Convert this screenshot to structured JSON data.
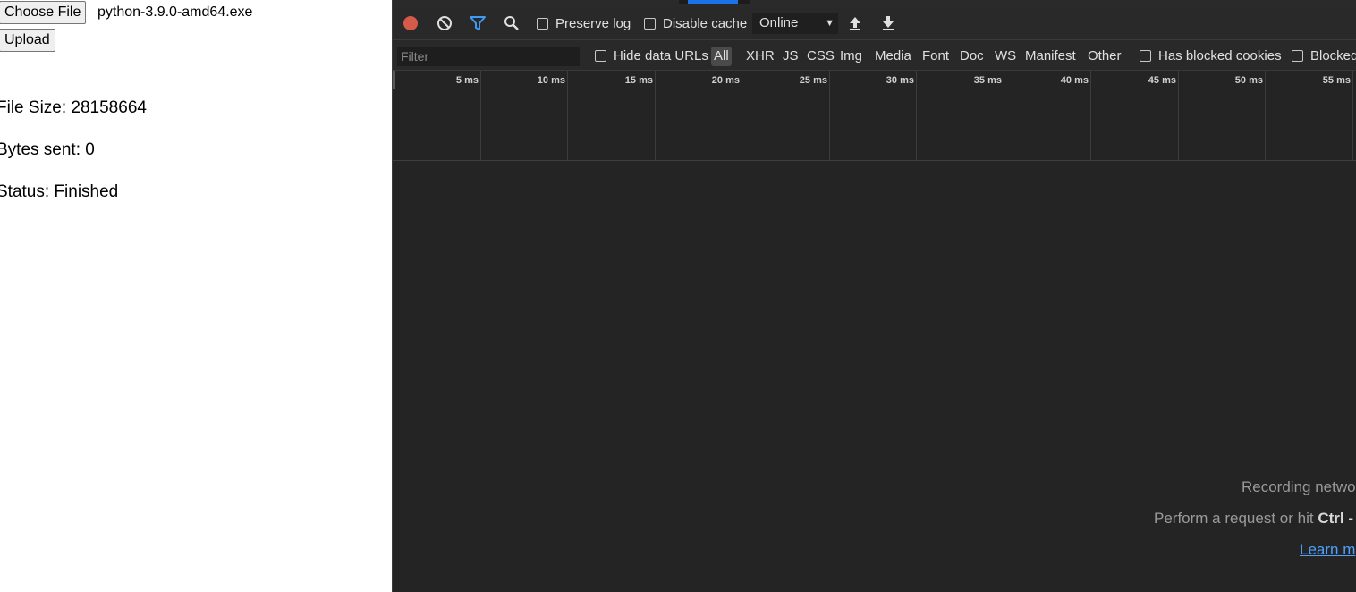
{
  "webpage": {
    "choose_file_label": "Choose File",
    "file_name": "python-3.9.0-amd64.exe",
    "upload_label": "Upload",
    "file_size_text": "File Size: 28158664",
    "bytes_sent_text": "Bytes sent: 0",
    "status_text": "Status: Finished"
  },
  "devtools": {
    "toolbar": {
      "record_icon": "record-icon",
      "clear_icon": "clear-icon",
      "filter_icon": "filter-icon",
      "search_icon": "search-icon",
      "preserve_log_label": "Preserve log",
      "disable_cache_label": "Disable cache",
      "throttle_value": "Online",
      "import_icon": "upload-icon",
      "export_icon": "download-icon"
    },
    "filter_bar": {
      "filter_placeholder": "Filter",
      "hide_data_urls_label": "Hide data URLs",
      "types": [
        "All",
        "XHR",
        "JS",
        "CSS",
        "Img",
        "Media",
        "Font",
        "Doc",
        "WS",
        "Manifest",
        "Other"
      ],
      "has_blocked_cookies_label": "Has blocked cookies",
      "blocked_requests_label": "Blocked"
    },
    "timeline_ticks": [
      "5 ms",
      "10 ms",
      "15 ms",
      "20 ms",
      "25 ms",
      "30 ms",
      "35 ms",
      "40 ms",
      "45 ms",
      "50 ms",
      "55 ms"
    ],
    "empty_state": {
      "line1": "Recording netwo",
      "line2_prefix": "Perform a request or hit ",
      "line2_key": "Ctrl -",
      "learn_more": "Learn m"
    },
    "colors": {
      "record": "#d45a4a",
      "filter_active": "#3d9bf5",
      "link": "#4ea1ff",
      "panel_bg": "#242424"
    }
  }
}
